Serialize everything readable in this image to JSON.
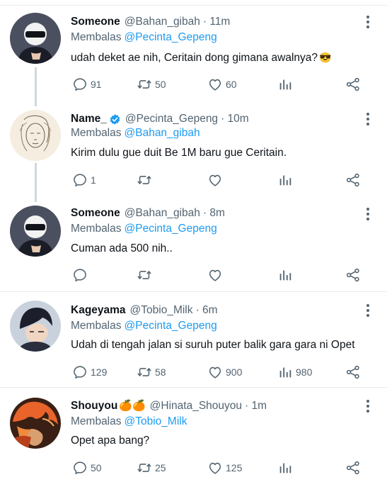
{
  "tweets": [
    {
      "name": "Someone",
      "handle": "@Bahan_gibah",
      "time": "· 11m",
      "reply_prefix": "Membalas",
      "reply_to": "@Pecinta_Gepeng",
      "text": "udah deket ae nih, Ceritain dong gimana awalnya?",
      "emoji": "😎",
      "replies": "91",
      "retweets": "50",
      "likes": "60",
      "views": ""
    },
    {
      "name": "Name_",
      "handle": "@Pecinta_Gepeng",
      "time": "· 10m",
      "reply_prefix": "Membalas",
      "reply_to": "@Bahan_gibah",
      "text": "Kirim dulu gue duit Be 1M baru gue Ceritain.",
      "replies": "1",
      "retweets": "",
      "likes": "",
      "views": ""
    },
    {
      "name": "Someone",
      "handle": "@Bahan_gibah",
      "time": "· 8m",
      "reply_prefix": "Membalas",
      "reply_to": "@Pecinta_Gepeng",
      "text": "Cuman ada 500 nih..",
      "replies": "",
      "retweets": "",
      "likes": "",
      "views": ""
    },
    {
      "name": "Kageyama",
      "handle": "@Tobio_Milk",
      "time": "· 6m",
      "reply_prefix": "Membalas",
      "reply_to": "@Pecinta_Gepeng",
      "text": "Udah di tengah jalan si suruh puter balik gara gara ni Opet",
      "replies": "129",
      "retweets": "58",
      "likes": "900",
      "views": "980"
    },
    {
      "name": "Shouyou",
      "name_emoji": "🍊🍊",
      "handle": "@Hinata_Shouyou",
      "time": "· 1m",
      "reply_prefix": "Membalas",
      "reply_to": "@Tobio_Milk",
      "text": "Opet apa bang?",
      "replies": "50",
      "retweets": "25",
      "likes": "125",
      "views": ""
    }
  ],
  "colors": {
    "accent": "#1d9bf0",
    "muted": "#536471",
    "text": "#0f1419",
    "divider": "#e6ecf0",
    "thread": "#cfd9de"
  },
  "icons": [
    "reply-icon",
    "retweet-icon",
    "like-icon",
    "stats-icon",
    "share-icon",
    "more-icon",
    "verified-icon"
  ]
}
